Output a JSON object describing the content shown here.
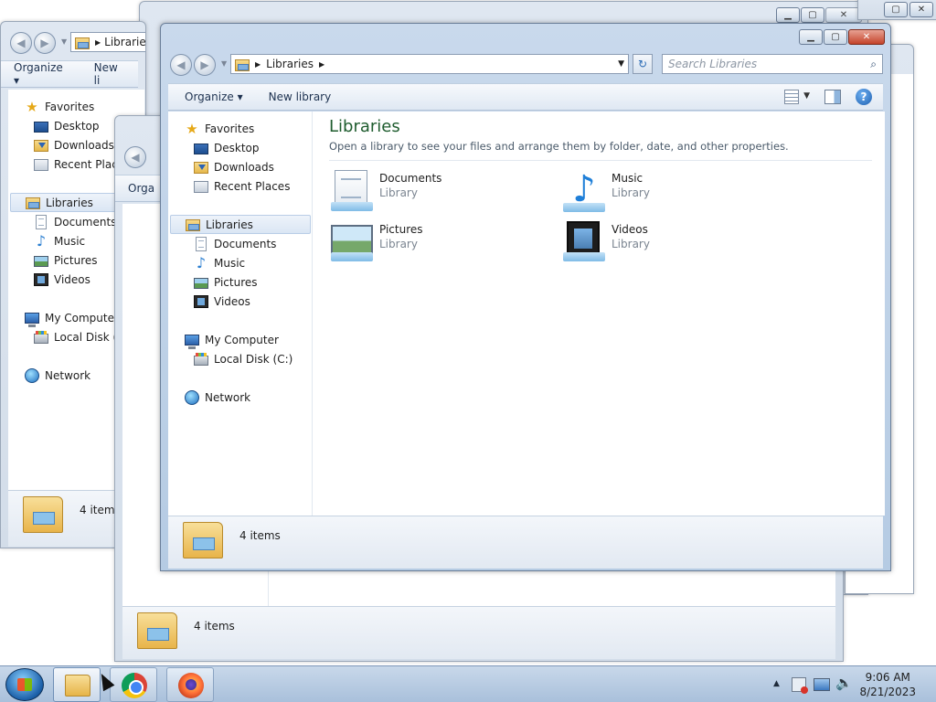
{
  "window": {
    "breadcrumb": "Libraries",
    "search_placeholder": "Search Libraries",
    "caption": {
      "min": "▁",
      "max": "▢",
      "close": "✕"
    }
  },
  "toolbar": {
    "organize": "Organize ▾",
    "new_library": "New library",
    "new_library_short": "New li",
    "organize_short": "Orga"
  },
  "nav": {
    "favorites": "Favorites",
    "desktop": "Desktop",
    "downloads": "Downloads",
    "recent_places": "Recent Places",
    "recent_places_short": "Recent Place",
    "libraries": "Libraries",
    "documents": "Documents",
    "music": "Music",
    "pictures": "Pictures",
    "videos": "Videos",
    "my_computer": "My Computer",
    "local_disk": "Local Disk (C:)",
    "local_disk_short": "Local Disk (C",
    "network": "Network"
  },
  "content": {
    "title": "Libraries",
    "description": "Open a library to see your files and arrange them by folder, date, and other properties.",
    "items": [
      {
        "name": "Documents",
        "type": "Library"
      },
      {
        "name": "Music",
        "type": "Library"
      },
      {
        "name": "Pictures",
        "type": "Library"
      },
      {
        "name": "Videos",
        "type": "Library"
      }
    ]
  },
  "status": {
    "count": "4 items",
    "count_short": "4 items"
  },
  "taskbar": {
    "time": "9:06 AM",
    "date": "8/21/2023",
    "tray_arrow": "▲"
  },
  "colors": {
    "title_green": "#1e5c2e",
    "taskbar": "#a9c0db",
    "close_red": "#c4432a"
  }
}
